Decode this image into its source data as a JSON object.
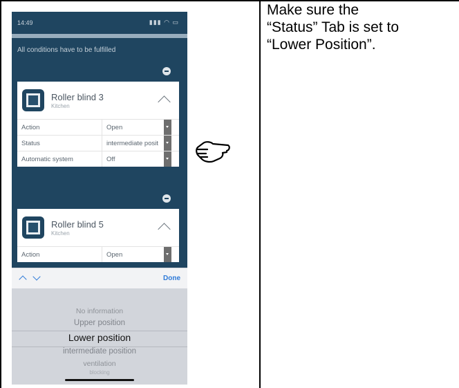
{
  "phone": {
    "status_time": "14:49",
    "status_icons": "▮▮▮ ◠ ▭",
    "conditions_text": "All conditions have to be fulfilled",
    "cards": [
      {
        "name": "Roller blind 3",
        "room": "Kitchen",
        "rows": [
          {
            "label": "Action",
            "value": "Open"
          },
          {
            "label": "Status",
            "value": "intermediate posit"
          },
          {
            "label": "Automatic system",
            "value": "Off"
          }
        ]
      },
      {
        "name": "Roller blind 5",
        "room": "Kitchen",
        "rows": [
          {
            "label": "Action",
            "value": "Open"
          }
        ]
      }
    ],
    "picker": {
      "done_label": "Done",
      "options": [
        "No information",
        "Upper position",
        "Lower position",
        "intermediate position",
        "ventilation",
        "blocking"
      ],
      "selected": "Lower position"
    }
  },
  "instruction": {
    "line1": "Make sure the",
    "line2": "“Status” Tab is set to",
    "line3": "“Lower Position”."
  }
}
